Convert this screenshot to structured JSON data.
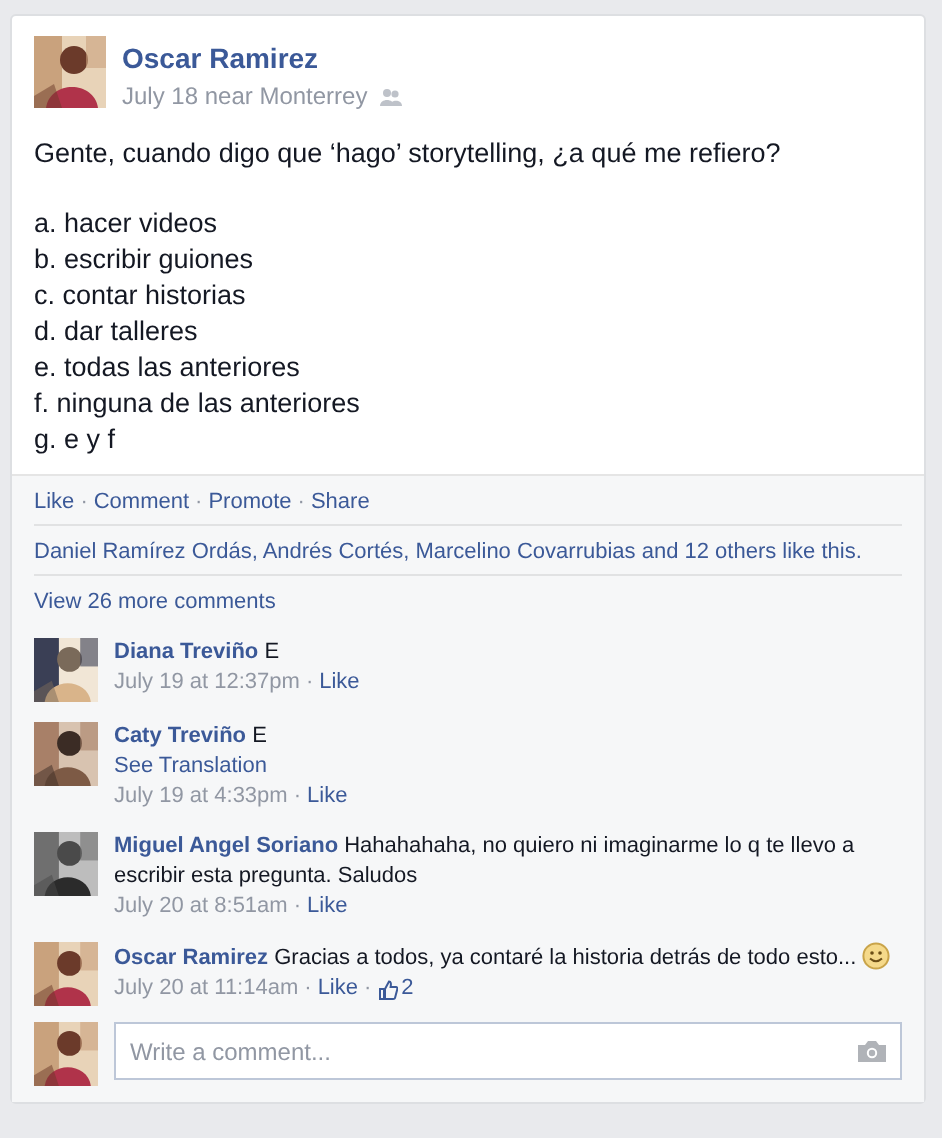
{
  "post": {
    "author": "Oscar Ramirez",
    "meta": "July 18 near Monterrey",
    "question": "Gente, cuando digo que ‘hago’ storytelling, ¿a qué me refiero?",
    "options": [
      "a. hacer videos",
      "b. escribir guiones",
      "c. contar historias",
      "d. dar talleres",
      "e. todas las anteriores",
      "f. ninguna de las anteriores",
      "g. e y f"
    ]
  },
  "separator": "·",
  "actions": [
    "Like",
    "Comment",
    "Promote",
    "Share"
  ],
  "likes_summary": "Daniel Ramírez Ordás, Andrés Cortés, Marcelino Covarrubias and 12 others like this.",
  "view_more": "View 26 more comments",
  "comments": [
    {
      "author": "Diana Treviño",
      "text": "E",
      "time": "July 19 at 12:37pm",
      "like": "Like",
      "emoticon": false
    },
    {
      "author": "Caty Treviño",
      "text": "E",
      "translation": "See Translation",
      "time": "July 19 at 4:33pm",
      "like": "Like",
      "emoticon": false
    },
    {
      "author": "Miguel Angel Soriano",
      "text": "Hahahahaha, no quiero ni imaginarme lo q te llevo a escribir esta pregunta. Saludos",
      "time": "July 20 at 8:51am",
      "like": "Like",
      "emoticon": false
    },
    {
      "author": "Oscar Ramirez",
      "text": "Gracias a todos, ya contaré la historia detrás de todo esto...",
      "time": "July 20 at 11:14am",
      "like": "Like",
      "like_count": "2",
      "emoticon": true
    }
  ],
  "composer": {
    "placeholder": "Write a comment..."
  }
}
